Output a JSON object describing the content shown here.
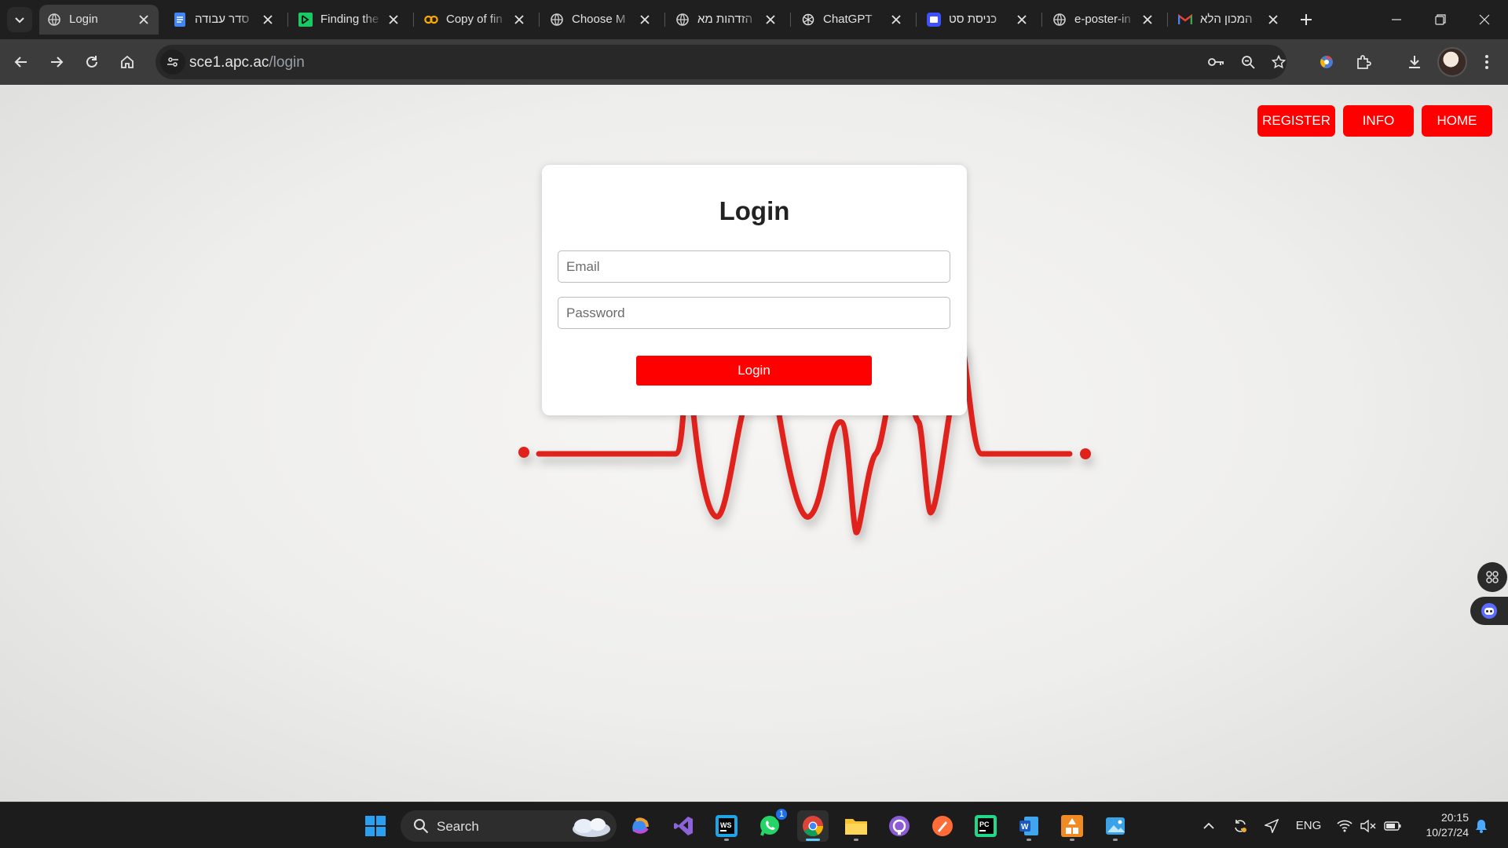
{
  "browser": {
    "tabs": [
      {
        "title": "Login",
        "icon": "globe-icon",
        "active": true
      },
      {
        "title": "סדר עבודה",
        "icon": "google-docs-icon"
      },
      {
        "title": "Finding the",
        "icon": "page-icon"
      },
      {
        "title": "Copy of fin",
        "icon": "colab-icon"
      },
      {
        "title": "Choose M",
        "icon": "globe-icon"
      },
      {
        "title": "הזדהות מא",
        "icon": "globe-icon"
      },
      {
        "title": "ChatGPT",
        "icon": "chatgpt-icon"
      },
      {
        "title": "כניסת סט",
        "icon": "portal-icon"
      },
      {
        "title": "e-poster-in",
        "icon": "globe-icon"
      },
      {
        "title": "המכון הלא",
        "icon": "gmail-icon"
      }
    ],
    "url_host": "sce1.apc.ac",
    "url_path": "/login"
  },
  "page": {
    "nav": {
      "register": "REGISTER",
      "info": "INFO",
      "home": "HOME"
    },
    "login_form": {
      "title": "Login",
      "email_placeholder": "Email",
      "password_placeholder": "Password",
      "submit_label": "Login"
    },
    "accent_color": "#ff0000"
  },
  "taskbar": {
    "search_label": "Search",
    "whatsapp_badge": "1",
    "language": "ENG",
    "time": "20:15",
    "date": "10/27/24"
  }
}
